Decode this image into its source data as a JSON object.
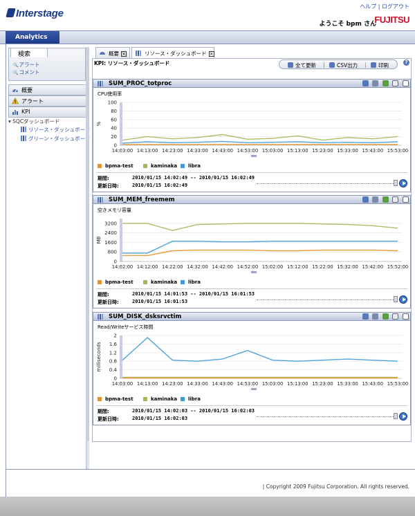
{
  "header": {
    "logo_text": "Interstage",
    "help_link": "ヘルプ",
    "separator": "|",
    "logout_link": "ログアウト",
    "welcome": "ようこそ bpm さん",
    "brand": "FUJITSU"
  },
  "nav": {
    "active_tab": "Analytics"
  },
  "sidebar": {
    "search_tab": "検索",
    "search_items": [
      "アラート",
      "コメント"
    ],
    "nav_items": [
      "概要",
      "アラート",
      "KPI"
    ],
    "tree_root": "SQCダッシュボード",
    "tree_children": [
      "リソース・ダッシュボード",
      "グリーン・ダッシュボード"
    ]
  },
  "tabs": [
    "概要",
    "リソース・ダッシュボード"
  ],
  "content": {
    "kpi_title": "KPI: リソース・ダッシュボード",
    "toolbar": [
      "全て更新",
      "CSV出力",
      "印刷"
    ]
  },
  "panels": [
    {
      "title": "SUM_PROC_totproc",
      "subtitle": "CPU使用率",
      "period_label": "期間:",
      "period_value": "2010/01/15 14:02:49 -- 2010/01/15 16:02:49",
      "updated_label": "更新日時:",
      "updated_value": "2010/01/15 16:02:49"
    },
    {
      "title": "SUM_MEM_freemem",
      "subtitle": "空きメモリ容量",
      "period_label": "期間:",
      "period_value": "2010/01/15 14:01:53 -- 2010/01/15 16:01:53",
      "updated_label": "更新日時:",
      "updated_value": "2010/01/15 16:01:53"
    },
    {
      "title": "SUM_DISK_dsksrvctim",
      "subtitle": "Read/Writeサービス時間",
      "period_label": "期間:",
      "period_value": "2010/01/15 14:02:03 -- 2010/01/15 16:02:03",
      "updated_label": "更新日時:",
      "updated_value": "2010/01/15 16:02:03"
    }
  ],
  "footer": {
    "copyright": "|  Copyright 2009 Fujitsu Corporation. All rights reserved."
  },
  "colors": {
    "bpma-test": "#e8922a",
    "kaminaka": "#a8b45a",
    "libra": "#3c9ad8"
  },
  "chart_data": [
    {
      "type": "line",
      "ylabel": "%",
      "ylim": [
        0,
        100
      ],
      "yticks": [
        0,
        20,
        40,
        60,
        80,
        100
      ],
      "categories": [
        "14:03:00",
        "14:13:00",
        "14:23:00",
        "14:33:00",
        "14:43:00",
        "14:53:00",
        "15:03:00",
        "15:13:00",
        "15:23:00",
        "15:33:00",
        "15:43:00",
        "15:53:00"
      ],
      "series": [
        {
          "name": "bpma-test",
          "values": [
            2,
            2,
            2,
            2,
            2,
            2,
            2,
            2,
            2,
            2,
            2,
            2
          ]
        },
        {
          "name": "kaminaka",
          "values": [
            12,
            20,
            15,
            18,
            25,
            14,
            16,
            22,
            12,
            18,
            15,
            20
          ]
        },
        {
          "name": "libra",
          "values": [
            5,
            8,
            6,
            7,
            9,
            6,
            7,
            8,
            6,
            7,
            6,
            8
          ]
        }
      ]
    },
    {
      "type": "line",
      "ylabel": "MB",
      "ylim": [
        0,
        3600
      ],
      "yticks": [
        0,
        800,
        1600,
        2400,
        3200
      ],
      "categories": [
        "14:02:00",
        "14:12:00",
        "14:22:00",
        "14:32:00",
        "14:42:00",
        "14:52:00",
        "15:02:00",
        "15:12:00",
        "15:22:00",
        "15:32:00",
        "15:42:00",
        "15:52:00"
      ],
      "series": [
        {
          "name": "bpma-test",
          "values": [
            500,
            500,
            900,
            950,
            950,
            950,
            900,
            900,
            950,
            950,
            950,
            900
          ]
        },
        {
          "name": "kaminaka",
          "values": [
            3200,
            3200,
            2600,
            3100,
            3150,
            3200,
            3200,
            3200,
            3150,
            3100,
            3000,
            2800
          ]
        },
        {
          "name": "libra",
          "values": [
            700,
            700,
            1700,
            1700,
            1650,
            1650,
            1700,
            1700,
            1700,
            1700,
            1700,
            1700
          ]
        }
      ]
    },
    {
      "type": "line",
      "ylabel": "milliseconds",
      "ylim": [
        0,
        2
      ],
      "yticks": [
        0,
        0.4,
        0.8,
        1.2,
        1.6,
        2
      ],
      "categories": [
        "14:03:00",
        "14:13:00",
        "14:23:00",
        "14:33:00",
        "14:43:00",
        "14:53:00",
        "15:03:00",
        "15:13:00",
        "15:23:00",
        "15:33:00",
        "15:43:00",
        "15:53:00"
      ],
      "series": [
        {
          "name": "bpma-test",
          "values": [
            0.02,
            0.02,
            0.02,
            0.02,
            0.02,
            0.02,
            0.02,
            0.02,
            0.02,
            0.02,
            0.02,
            0.02
          ]
        },
        {
          "name": "kaminaka",
          "values": [
            0.05,
            0.05,
            0.05,
            0.05,
            0.05,
            0.05,
            0.05,
            0.05,
            0.05,
            0.05,
            0.05,
            0.05
          ]
        },
        {
          "name": "libra",
          "values": [
            0.85,
            1.9,
            0.85,
            0.8,
            0.9,
            1.3,
            0.85,
            0.8,
            0.85,
            0.9,
            0.85,
            0.8
          ]
        }
      ]
    }
  ]
}
